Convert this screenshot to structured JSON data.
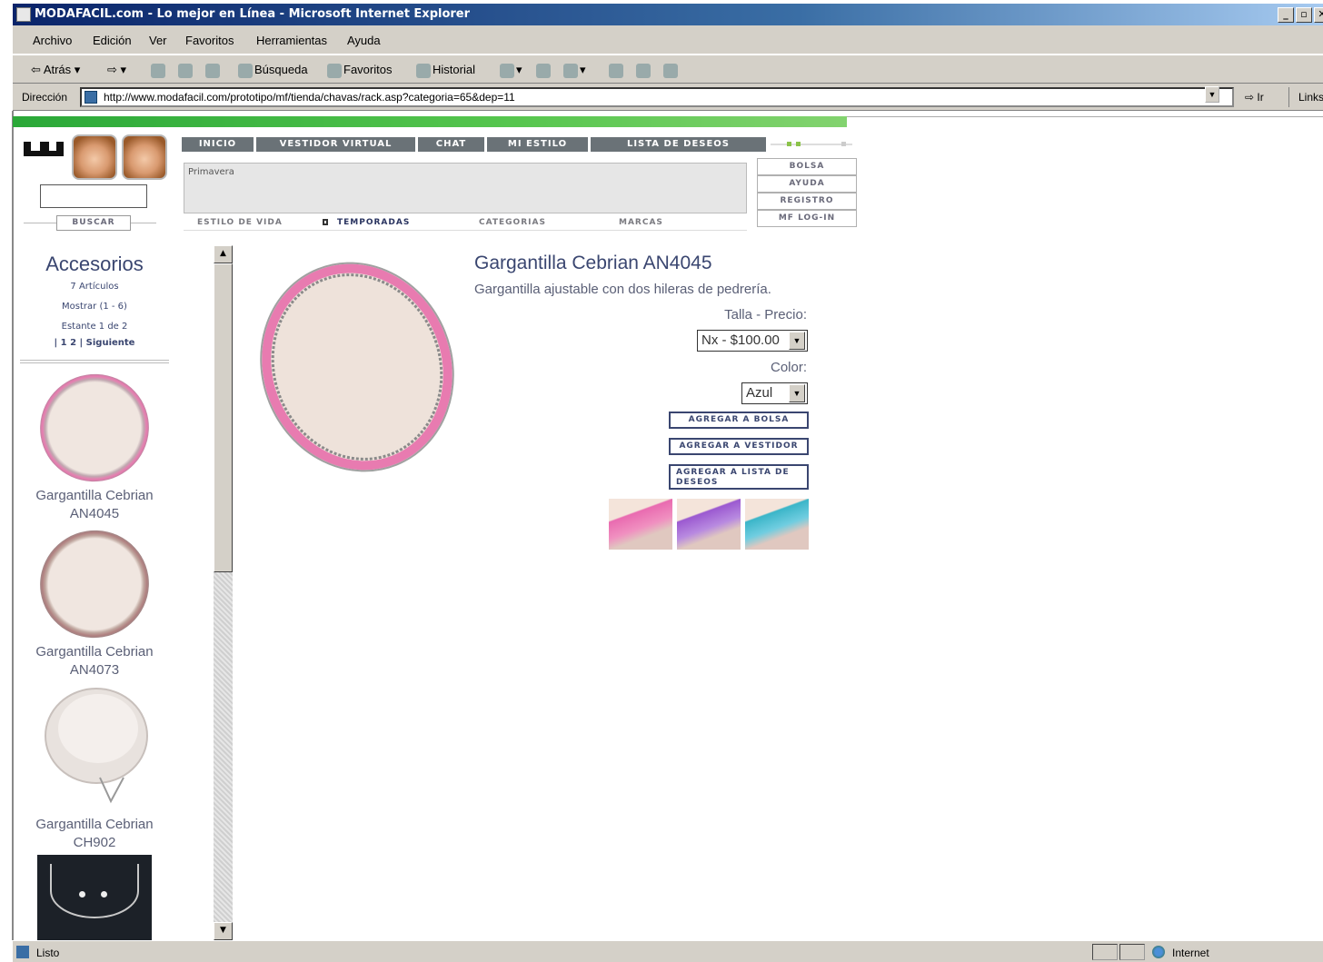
{
  "window": {
    "title": "MODAFACIL.com - Lo mejor en Línea - Microsoft Internet Explorer",
    "controls": [
      "_",
      "▫",
      "✕"
    ]
  },
  "menu": [
    "Archivo",
    "Edición",
    "Ver",
    "Favoritos",
    "Herramientas",
    "Ayuda"
  ],
  "toolbar": {
    "back": "Atrás",
    "search": "Búsqueda",
    "favorites": "Favoritos",
    "history": "Historial"
  },
  "address": {
    "label": "Dirección",
    "url": "http://www.modafacil.com/prototipo/mf/tienda/chavas/rack.asp?categoria=65&dep=11",
    "go": "Ir",
    "links": "Links"
  },
  "site": {
    "logo": "ω",
    "search_button": "BUSCAR",
    "nav": [
      "INICIO",
      "VESTIDOR VIRTUAL",
      "CHAT",
      "MI ESTILO",
      "LISTA DE DESEOS"
    ],
    "season_text": "Primavera",
    "side_buttons": [
      "BOLSA",
      "AYUDA",
      "REGISTRO",
      "MF LOG-IN"
    ],
    "subnav": [
      "ESTILO DE VIDA",
      "TEMPORADAS",
      "CATEGORIAS",
      "MARCAS"
    ]
  },
  "category": {
    "title": "Accesorios",
    "count": "7 Artículos",
    "showing": "Mostrar (1 - 6)",
    "shelf": "Estante 1 de 2",
    "pages": "| 1 2 | Siguiente"
  },
  "items": [
    {
      "name_line1": "Gargantilla Cebrian",
      "name_line2": "AN4045"
    },
    {
      "name_line1": "Gargantilla Cebrian",
      "name_line2": "AN4073"
    },
    {
      "name_line1": "Gargantilla Cebrian",
      "name_line2": "CH902"
    }
  ],
  "product": {
    "title": "Gargantilla Cebrian AN4045",
    "description": "Gargantilla ajustable con dos hileras de pedrería.",
    "talla_label": "Talla - Precio:",
    "talla_value": "Nx - $100.00",
    "color_label": "Color:",
    "color_value": "Azul",
    "btn_bolsa": "AGREGAR A BOLSA",
    "btn_vestidor": "AGREGAR A VESTIDOR",
    "btn_lista": "AGREGAR A LISTA DE DESEOS",
    "swatch_colors": [
      "#e96bb0",
      "#9b59d0",
      "#3bb5c8"
    ]
  },
  "status": {
    "text": "Listo",
    "zone": "Internet"
  },
  "colors": {
    "accent_green": "#2aa838",
    "nav_grey": "#6a7277",
    "title_blue": "#3a4670"
  }
}
